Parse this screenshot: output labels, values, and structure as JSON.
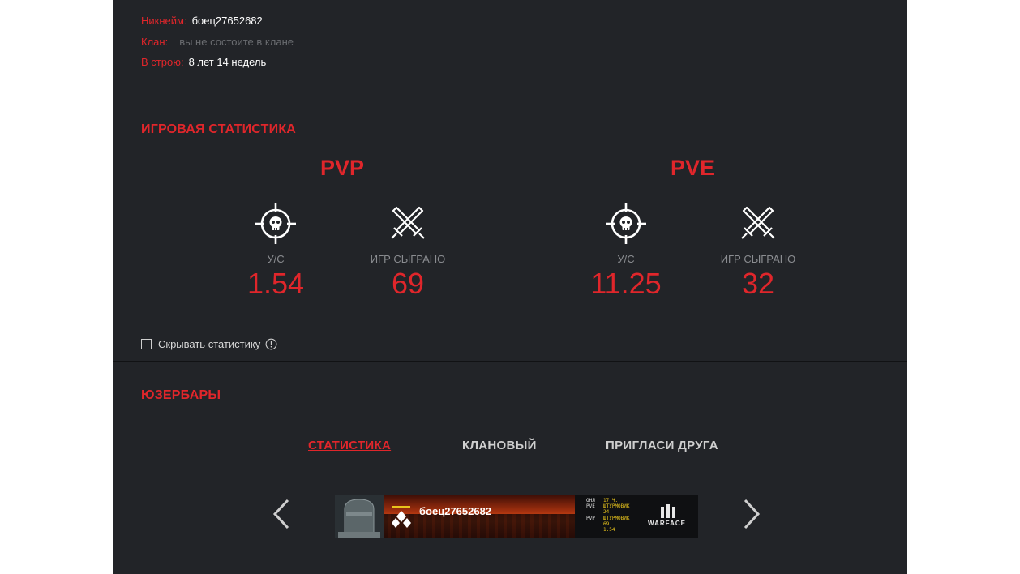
{
  "profile": {
    "nickname_label": "Никнейм:",
    "nickname": "боец27652682",
    "clan_label": "Клан:",
    "clan_value": "вы не состоите в клане",
    "service_label": "В строю:",
    "service_value": "8 лет 14 недель"
  },
  "stats": {
    "title": "ИГРОВАЯ СТАТИСТИКА",
    "pvp": {
      "title": "PVP",
      "ratio_label": "У/С",
      "ratio": "1.54",
      "games_label": "ИГР СЫГРАНО",
      "games": "69"
    },
    "pve": {
      "title": "PVE",
      "ratio_label": "У/С",
      "ratio": "11.25",
      "games_label": "ИГР СЫГРАНО",
      "games": "32"
    },
    "hide_label": "Скрывать статистику",
    "hide_checked": false
  },
  "userbars": {
    "title": "ЮЗЕРБАРЫ",
    "tabs": [
      {
        "label": "СТАТИСТИКА",
        "active": true
      },
      {
        "label": "КЛАНОВЫЙ",
        "active": false
      },
      {
        "label": "ПРИГЛАСИ ДРУГА",
        "active": false
      }
    ],
    "banner": {
      "name": "боец27652682",
      "row1_key": "ОНЛ",
      "row1_val": "17 Ч.",
      "row2_key": "PVE",
      "row2_val": "ШТУРМОВИК",
      "row3_val": "24",
      "row4_key": "PVP",
      "row4_val": "ШТУРМОВИК",
      "row5_val": "69",
      "row6_val": "1.54",
      "brand": "WARFACE"
    }
  },
  "colors": {
    "accent": "#e0262b",
    "panel_bg": "#222428",
    "muted_text": "#6a6c70"
  },
  "icons": {
    "kd": "crosshair-skull-icon",
    "games": "crossed-swords-icon",
    "info": "info-icon",
    "prev": "chevron-left-icon",
    "next": "chevron-right-icon"
  }
}
